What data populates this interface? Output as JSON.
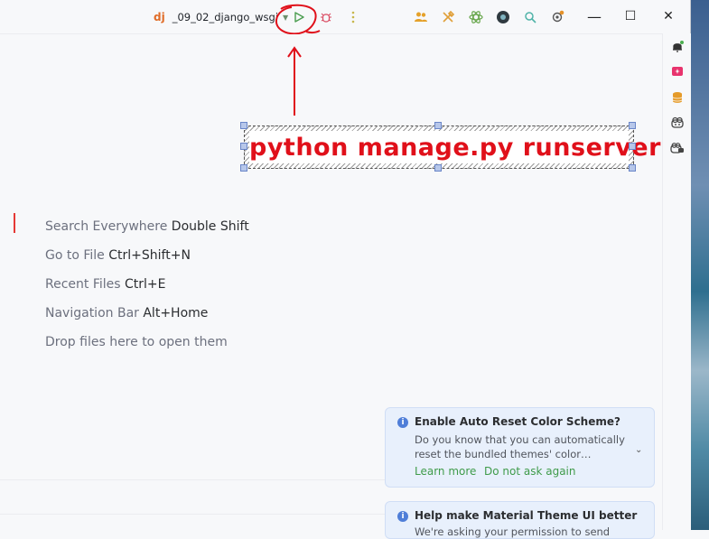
{
  "titlebar": {
    "project_logo": "dj",
    "project_name": "_09_02_django_wsgi",
    "icons": [
      "run-icon",
      "debug-icon",
      "more-vertical-icon",
      "code-with-me-icon",
      "build-tools-icon",
      "ai-assistant-icon",
      "profile-icon",
      "search-icon"
    ]
  },
  "window_controls": {
    "minimize": "—",
    "maximize": "☐",
    "close": "✕"
  },
  "annotation": {
    "text": "python manage.py runserver",
    "color": "#e0101a"
  },
  "hints": [
    {
      "label": "Search Everywhere",
      "key": "Double Shift"
    },
    {
      "label": "Go to File",
      "key": "Ctrl+Shift+N"
    },
    {
      "label": "Recent Files",
      "key": "Ctrl+E"
    },
    {
      "label": "Navigation Bar",
      "key": "Alt+Home"
    },
    {
      "label": "Drop files here to open them",
      "key": ""
    }
  ],
  "notifications": [
    {
      "title": "Enable Auto Reset Color Scheme?",
      "body": "Do you know that you can automatically reset the bundled themes' color…",
      "actions": [
        "Learn more",
        "Do not ask again"
      ]
    },
    {
      "title": "Help make Material Theme UI better",
      "body": "We're asking your permission to send"
    }
  ],
  "right_strip_icons": [
    "notifications-icon",
    "ai-chat-icon",
    "database-icon",
    "copilot-icon",
    "copilot-chat-icon"
  ],
  "colors": {
    "accent_green": "#3f9b4a",
    "annotation_red": "#e0101a",
    "notif_bg": "#e8f0fc"
  }
}
